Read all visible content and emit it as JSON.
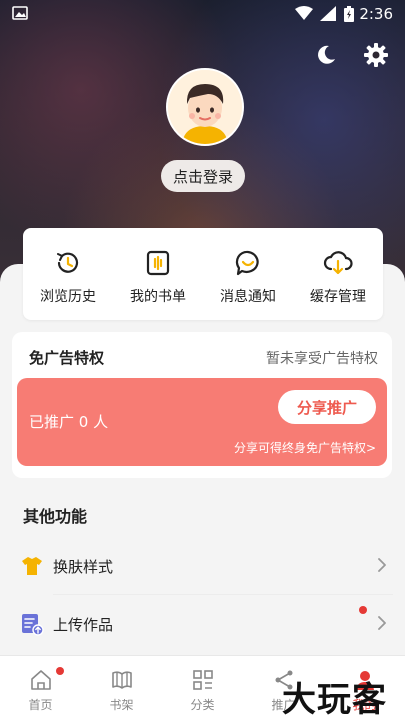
{
  "status_bar": {
    "time": "2:36"
  },
  "profile": {
    "login_label": "点击登录"
  },
  "quick_actions": [
    {
      "icon": "history-icon",
      "label": "浏览历史"
    },
    {
      "icon": "booklist-icon",
      "label": "我的书单"
    },
    {
      "icon": "message-icon",
      "label": "消息通知"
    },
    {
      "icon": "cloud-download-icon",
      "label": "缓存管理"
    }
  ],
  "ad_free": {
    "title": "免广告特权",
    "status": "暂未享受广告特权",
    "promoted": "已推广 0 人",
    "share_label": "分享推广",
    "hint": "分享可得终身免广告特权>"
  },
  "other_functions": {
    "title": "其他功能",
    "items": [
      {
        "icon": "shirt-icon",
        "label": "换肤样式"
      },
      {
        "icon": "upload-doc-icon",
        "label": "上传作品"
      }
    ]
  },
  "tabs": [
    {
      "icon": "home-icon",
      "label": "首页"
    },
    {
      "icon": "bookshelf-icon",
      "label": "书架"
    },
    {
      "icon": "category-icon",
      "label": "分类"
    },
    {
      "icon": "share-icon",
      "label": "推广"
    },
    {
      "icon": "profile-icon",
      "label": "我的"
    }
  ],
  "watermark": "大玩客",
  "colors": {
    "accent": "#f77c74",
    "share_text": "#ee5a4f",
    "badge": "#e53935",
    "tshirt": "#f5b301",
    "upload": "#6a72d8"
  }
}
